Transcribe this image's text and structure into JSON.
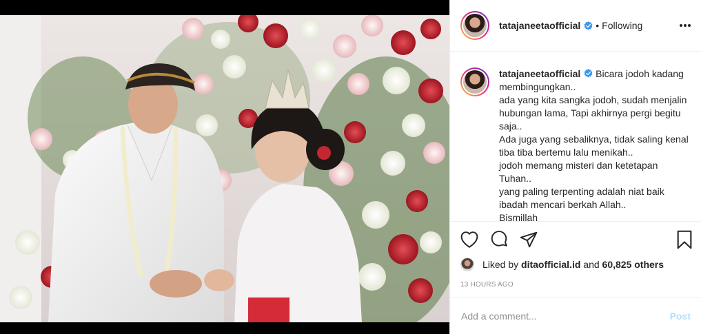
{
  "post": {
    "author": {
      "username": "tatajaneetaofficial",
      "verified_icon": "verified-badge-icon",
      "separator": "•",
      "follow_status": "Following"
    },
    "more_icon": "more-options-icon",
    "caption": {
      "username": "tatajaneetaofficial",
      "text": "Bicara jodoh kadang membingungkan..\nada yang kita sangka jodoh, sudah menjalin hubungan lama, Tapi akhirnya pergi begitu saja..\nAda juga yang sebaliknya, tidak saling kenal tiba tiba bertemu lalu menikah..\njodoh memang misteri dan ketetapan Tuhan..\nyang paling terpenting adalah niat baik ibadah mencari berkah Allah..\nBismillah"
    },
    "actions": {
      "like_icon": "heart-icon",
      "comment_icon": "comment-icon",
      "share_icon": "share-icon",
      "save_icon": "bookmark-icon"
    },
    "likes": {
      "prefix": "Liked by",
      "liker": "ditaofficial.id",
      "conjunction": "and",
      "others": "60,825 others"
    },
    "timestamp": "13 HOURS AGO",
    "comment": {
      "placeholder": "Add a comment...",
      "post_label": "Post"
    },
    "colors": {
      "accent_blue": "#0095f6",
      "post_disabled": "#b2dffc",
      "verified_blue": "#3897f0"
    }
  }
}
